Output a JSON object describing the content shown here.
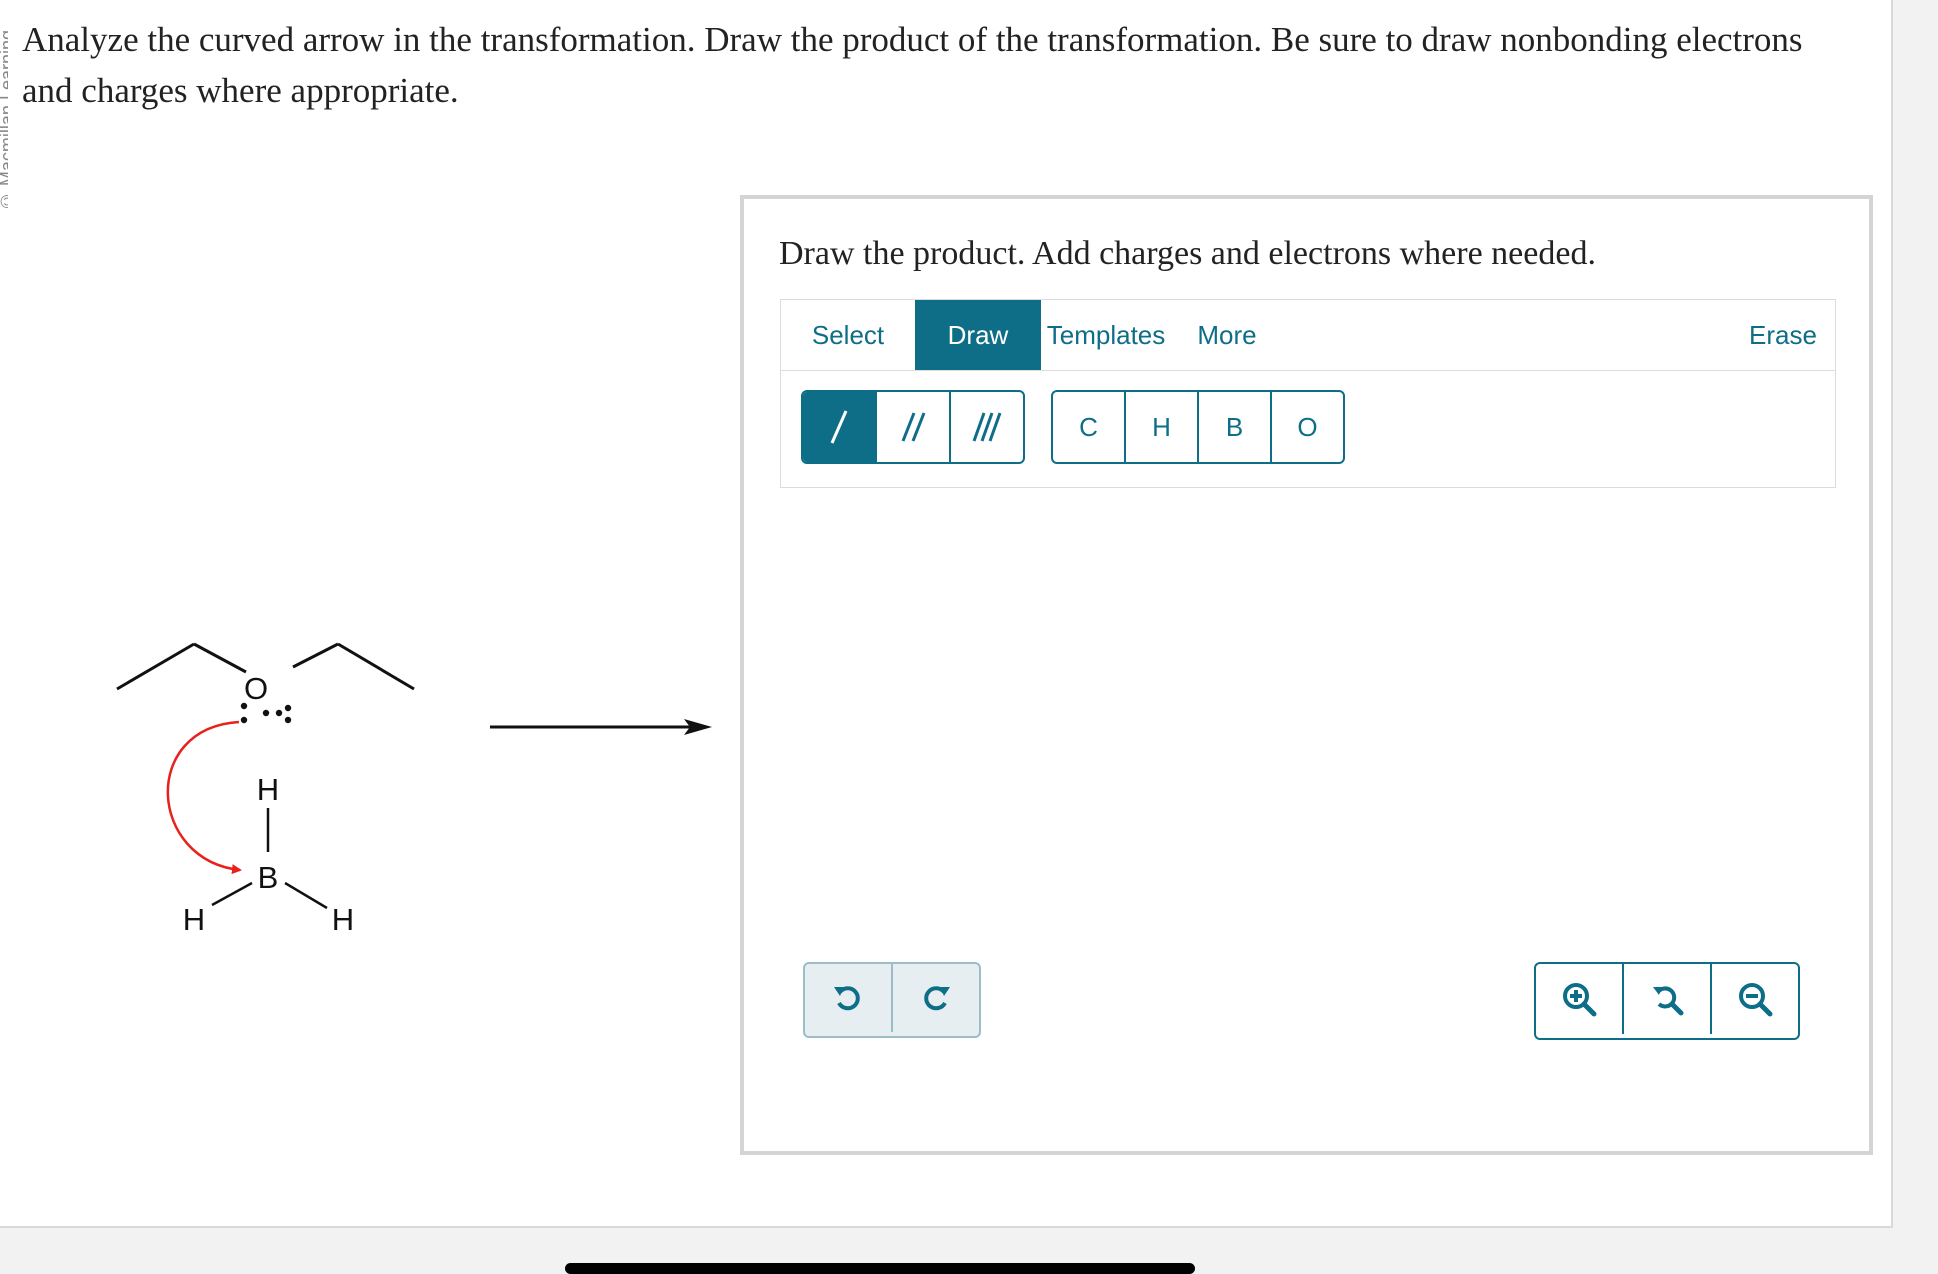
{
  "question": {
    "line1": "Analyze the curved arrow in the transformation. Draw the product of the transformation. Be sure to draw nonbonding electrons",
    "line2": "and charges where appropriate."
  },
  "side_label": "© Macmillan Learning",
  "reactant": {
    "atoms": {
      "oxygen": "O",
      "boron": "B",
      "h_top": "H",
      "h_left": "H",
      "h_right": "H"
    },
    "arrow_color": "#e8211c"
  },
  "panel": {
    "title": "Draw the product. Add charges and electrons where needed.",
    "tabs": [
      "Select",
      "Draw",
      "Templates",
      "More"
    ],
    "active_tab": "Draw",
    "erase_label": "Erase",
    "bond_tools": [
      "single-bond",
      "double-bond",
      "triple-bond"
    ],
    "atom_tools": [
      "C",
      "H",
      "B",
      "O"
    ],
    "accent_color": "#0f6e87"
  }
}
